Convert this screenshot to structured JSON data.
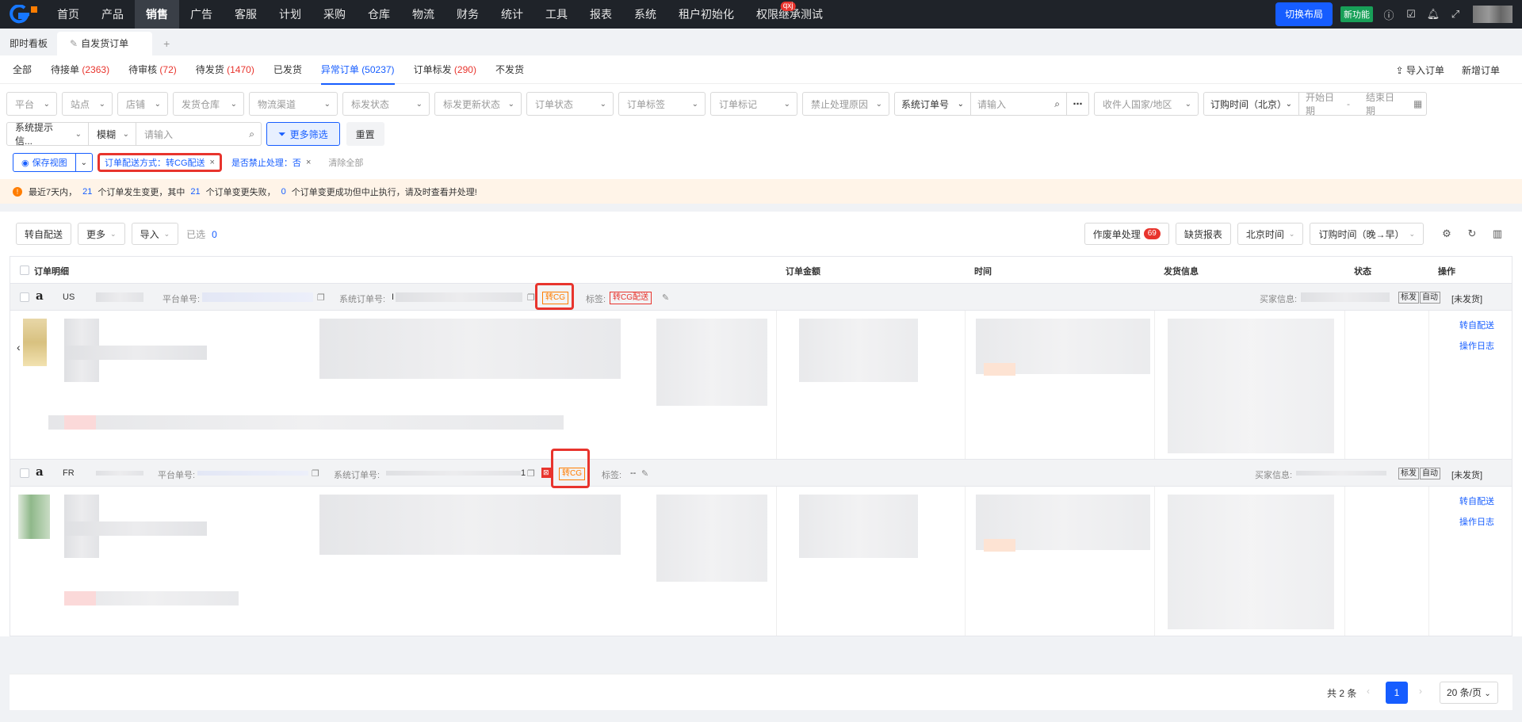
{
  "topnav": {
    "items": [
      {
        "label": "首页"
      },
      {
        "label": "产品"
      },
      {
        "label": "销售"
      },
      {
        "label": "广告"
      },
      {
        "label": "客服"
      },
      {
        "label": "计划"
      },
      {
        "label": "采购"
      },
      {
        "label": "仓库"
      },
      {
        "label": "物流"
      },
      {
        "label": "财务"
      },
      {
        "label": "统计"
      },
      {
        "label": "工具"
      },
      {
        "label": "报表"
      },
      {
        "label": "系统"
      },
      {
        "label": "租户初始化"
      },
      {
        "label": "权限继承测试"
      }
    ],
    "active_index": 2,
    "badge_text": "qxj",
    "switch_layout": "切换布局",
    "new_feature": "新功能"
  },
  "page_tabs": [
    {
      "label": "即时看板"
    },
    {
      "label": "自发货订单"
    }
  ],
  "subtabs": [
    {
      "label": "全部",
      "count": ""
    },
    {
      "label": "待接单",
      "count": "(2363)"
    },
    {
      "label": "待审核",
      "count": "(72)"
    },
    {
      "label": "待发货",
      "count": "(1470)"
    },
    {
      "label": "已发货",
      "count": ""
    },
    {
      "label": "异常订单",
      "count": "(50237)"
    },
    {
      "label": "订单标发",
      "count": "(290)"
    },
    {
      "label": "不发货",
      "count": ""
    }
  ],
  "actions": {
    "import_order": "导入订单",
    "new_order": "新增订单"
  },
  "filters": {
    "row1": [
      "平台",
      "站点",
      "店铺",
      "发货仓库",
      "物流渠道",
      "标发状态",
      "标发更新状态",
      "订单状态",
      "订单标签",
      "订单标记",
      "禁止处理原因"
    ],
    "order_no_type": "系统订单号",
    "order_no_placeholder": "请输入",
    "recipient_country": "收件人国家/地区",
    "time_type": "订购时间（北京）",
    "start_date": "开始日期",
    "date_sep": "-",
    "end_date": "结束日期",
    "sys_hint": "系统提示信...",
    "match_mode": "模糊",
    "keyword_placeholder": "请输入",
    "more_filter": "更多筛选",
    "reset": "重置"
  },
  "chips": {
    "save_view": "保存视图",
    "chip1": "订单配送方式：转CG配送",
    "chip2": "是否禁止处理：否",
    "clear_all": "清除全部"
  },
  "alert": {
    "t1": "最近7天内，",
    "n1": "21",
    "t2": "个订单发生变更，其中",
    "n2": "21",
    "t3": "个订单变更失败，",
    "n3": "0",
    "t4": "个订单变更成功但中止执行，请及时查看并处理!"
  },
  "toolbar": {
    "transfer_self": "转自配送",
    "more": "更多",
    "import": "导入",
    "selected_label": "已选",
    "selected_count": "0",
    "void_process": "作废单处理",
    "void_count": "69",
    "missing_report": "缺货报表",
    "timezone": "北京时间",
    "sort": "订购时间（晚→早）"
  },
  "table": {
    "headers": {
      "detail": "订单明细",
      "amount": "订单金额",
      "time": "时间",
      "shipping": "发货信息",
      "status": "状态",
      "op": "操作"
    },
    "orders": [
      {
        "site": "US",
        "platform_no_label": "平台单号:",
        "sys_no_label": "系统订单号:",
        "sys_no_prefix": "I",
        "cg_tag": "转CG",
        "tag_label": "标签:",
        "tag_value": "转CG配送",
        "buyer_label": "买家信息:",
        "mark1": "标发",
        "mark2": "自动",
        "status": "[未发货]",
        "op1": "转自配送",
        "op2": "操作日志"
      },
      {
        "site": "FR",
        "platform_no_label": "平台单号:",
        "sys_no_label": "系统订单号:",
        "sys_no_suffix": "1",
        "cg_tag": "转CG",
        "tag_label": "标签:",
        "tag_value": "--",
        "buyer_label": "买家信息:",
        "mark1": "标发",
        "mark2": "自动",
        "status": "[未发货]",
        "op1": "转自配送",
        "op2": "操作日志"
      }
    ]
  },
  "pager": {
    "total": "共 2 条",
    "page": "1",
    "page_size": "20 条/页"
  },
  "colors": {
    "primary": "#165dff",
    "danger": "#e8342d",
    "warning": "#ff7d00",
    "nav_bg": "#1f2329"
  }
}
